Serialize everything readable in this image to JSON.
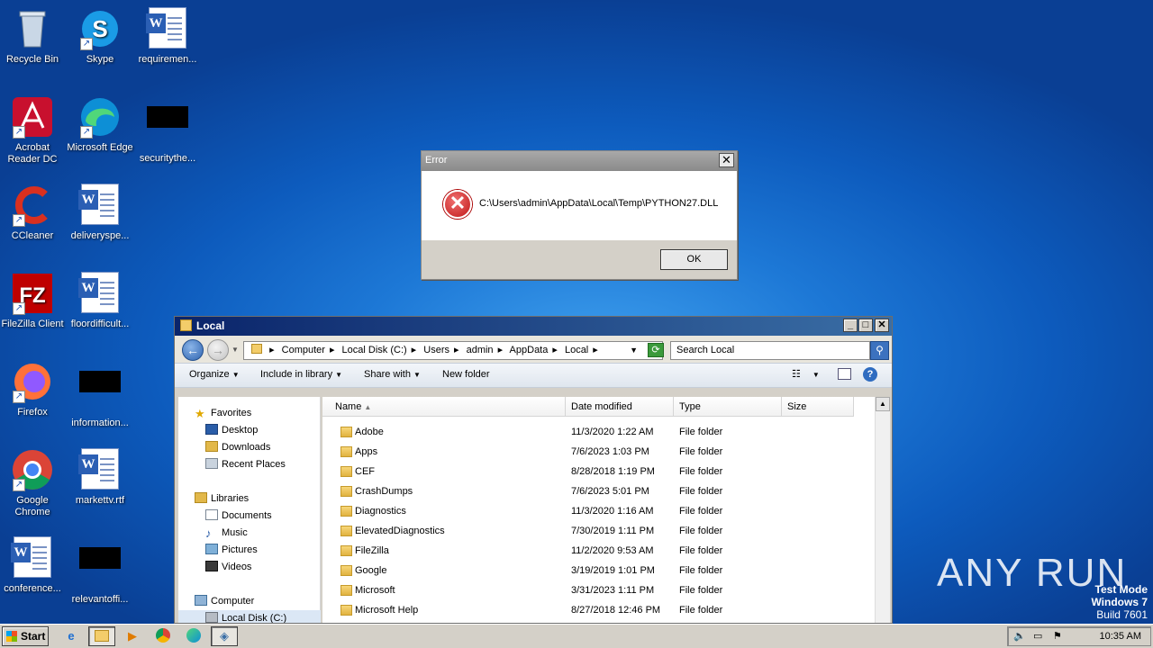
{
  "desktop": {
    "icons": [
      {
        "label": "Recycle Bin",
        "icon": "recycle-bin-icon"
      },
      {
        "label": "Skype",
        "icon": "skype-icon"
      },
      {
        "label": "requiremen...",
        "icon": "word-document-icon"
      },
      {
        "label": "Acrobat Reader DC",
        "icon": "acrobat-icon"
      },
      {
        "label": "Microsoft Edge",
        "icon": "edge-icon"
      },
      {
        "label": "securitythe...",
        "icon": "black-file-icon"
      },
      {
        "label": "CCleaner",
        "icon": "ccleaner-icon"
      },
      {
        "label": "deliveryspe...",
        "icon": "word-document-icon"
      },
      {
        "label": "FileZilla Client",
        "icon": "filezilla-icon"
      },
      {
        "label": "floordifficult...",
        "icon": "word-document-icon"
      },
      {
        "label": "Firefox",
        "icon": "firefox-icon"
      },
      {
        "label": "information...",
        "icon": "black-file-icon"
      },
      {
        "label": "Google Chrome",
        "icon": "chrome-icon"
      },
      {
        "label": "markettv.rtf",
        "icon": "word-document-icon"
      },
      {
        "label": "conference...",
        "icon": "word-document-icon"
      },
      {
        "label": "relevantoffi...",
        "icon": "black-file-icon"
      }
    ],
    "watermark": "ANY RUN",
    "test_mode": {
      "line1": "Test Mode",
      "line2": "Windows 7",
      "line3": "Build 7601"
    }
  },
  "error_dialog": {
    "title": "Error",
    "close": "✕",
    "message": "C:\\Users\\admin\\AppData\\Local\\Temp\\PYTHON27.DLL",
    "ok_label": "OK"
  },
  "explorer": {
    "title": "Local",
    "window_buttons": {
      "minimize": "_",
      "maximize": "□",
      "close": "✕"
    },
    "breadcrumb": [
      "Computer",
      "Local Disk (C:)",
      "Users",
      "admin",
      "AppData",
      "Local"
    ],
    "search_placeholder": "Search Local",
    "toolbar": {
      "organize": "Organize",
      "include": "Include in library",
      "share": "Share with",
      "new_folder": "New folder"
    },
    "nav": {
      "favorites": "Favorites",
      "desktop": "Desktop",
      "downloads": "Downloads",
      "recent": "Recent Places",
      "libraries": "Libraries",
      "documents": "Documents",
      "music": "Music",
      "pictures": "Pictures",
      "videos": "Videos",
      "computer": "Computer",
      "local_disk": "Local Disk (C:)"
    },
    "columns": {
      "name": "Name",
      "date": "Date modified",
      "type": "Type",
      "size": "Size"
    },
    "rows": [
      {
        "name": "Adobe",
        "date": "11/3/2020 1:22 AM",
        "type": "File folder"
      },
      {
        "name": "Apps",
        "date": "7/6/2023 1:03 PM",
        "type": "File folder"
      },
      {
        "name": "CEF",
        "date": "8/28/2018 1:19 PM",
        "type": "File folder"
      },
      {
        "name": "CrashDumps",
        "date": "7/6/2023 5:01 PM",
        "type": "File folder"
      },
      {
        "name": "Diagnostics",
        "date": "11/3/2020 1:16 AM",
        "type": "File folder"
      },
      {
        "name": "ElevatedDiagnostics",
        "date": "7/30/2019 1:11 PM",
        "type": "File folder"
      },
      {
        "name": "FileZilla",
        "date": "11/2/2020 9:53 AM",
        "type": "File folder"
      },
      {
        "name": "Google",
        "date": "3/19/2019 1:01 PM",
        "type": "File folder"
      },
      {
        "name": "Microsoft",
        "date": "3/31/2023 1:11 PM",
        "type": "File folder"
      },
      {
        "name": "Microsoft Help",
        "date": "8/27/2018 12:46 PM",
        "type": "File folder"
      }
    ]
  },
  "taskbar": {
    "start_label": "Start",
    "clock": "10:35 AM"
  }
}
